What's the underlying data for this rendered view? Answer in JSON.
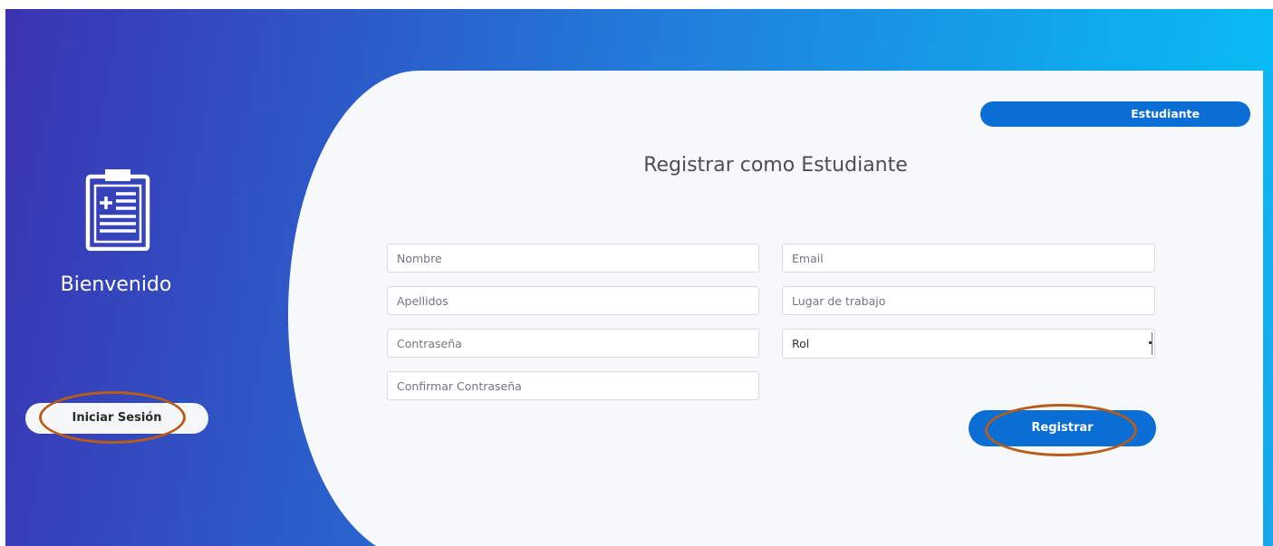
{
  "left": {
    "welcome": "Bienvenido",
    "login_button": "Iniciar Sesión",
    "icon": "clipboard-medical-icon"
  },
  "tabs": {
    "role_tab": "Estudiante"
  },
  "form": {
    "title": "Registrar como Estudiante",
    "fields": {
      "nombre_placeholder": "Nombre",
      "apellidos_placeholder": "Apellidos",
      "contrasena_placeholder": "Contraseña",
      "confirmar_placeholder": "Confirmar Contraseña",
      "email_placeholder": "Email",
      "lugar_placeholder": "Lugar de trabajo"
    },
    "role_select_value": "Rol",
    "submit_label": "Registrar"
  },
  "colors": {
    "gradient_start": "#3b33b2",
    "gradient_end": "#06c3f7",
    "accent": "#0b6ed4",
    "annotation": "#b85c1a",
    "panel_bg": "#f6f8f9"
  }
}
